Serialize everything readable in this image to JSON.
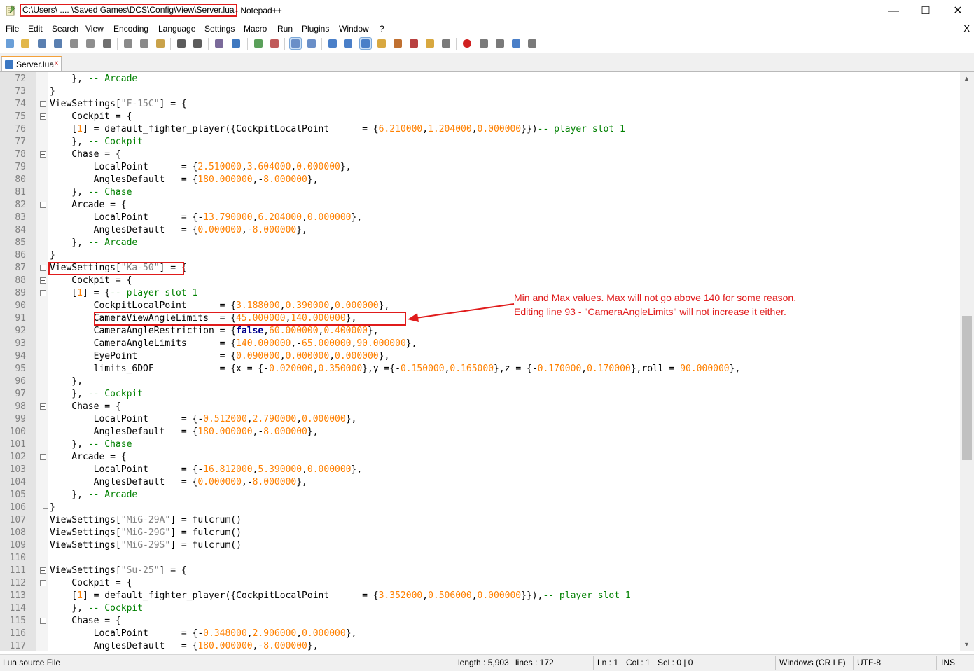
{
  "window": {
    "title_path": "C:\\Users\\ .... \\Saved Games\\DCS\\Config\\View\\Server.lua",
    "title_app": " - Notepad++",
    "minimize": "—",
    "maximize": "☐",
    "close": "✕"
  },
  "menu": {
    "items": [
      "File",
      "Edit",
      "Search",
      "View",
      "Encoding",
      "Language",
      "Settings",
      "Macro",
      "Run",
      "Plugins",
      "Window",
      "?"
    ],
    "close_doc": "X"
  },
  "toolbar": {
    "icons": [
      "new-file-icon",
      "open-file-icon",
      "save-icon",
      "save-all-icon",
      "close-icon",
      "close-all-icon",
      "print-icon",
      "cut-icon",
      "copy-icon",
      "paste-icon",
      "undo-icon",
      "redo-icon",
      "find-icon",
      "replace-icon",
      "zoom-in-icon",
      "zoom-out-icon",
      "sync-vertical-icon",
      "sync-horizontal-icon",
      "word-wrap-icon",
      "show-all-chars-icon",
      "indent-guide-icon",
      "udl-icon",
      "doc-map-icon",
      "function-list-icon",
      "folder-workspace-icon",
      "monitor-icon",
      "macro-record-icon",
      "macro-stop-icon",
      "macro-play-icon",
      "macro-run-multiple-icon",
      "macro-save-icon"
    ]
  },
  "tab": {
    "label": "Server.lua",
    "close": "x"
  },
  "editor": {
    "lines": [
      {
        "n": "72",
        "html": "    }, <span class=\"c\">-- Arcade</span>"
      },
      {
        "n": "73",
        "html": "}"
      },
      {
        "n": "74",
        "html": "ViewSettings[<span class=\"s\">\"F-15C\"</span>] = {"
      },
      {
        "n": "75",
        "html": "    Cockpit = {"
      },
      {
        "n": "76",
        "html": "    [<span class=\"n\">1</span>] = default_fighter_player({CockpitLocalPoint      = {<span class=\"n\">6.210000</span>,<span class=\"n\">1.204000</span>,<span class=\"n\">0.000000</span>}})<span class=\"c\">-- player slot 1</span>"
      },
      {
        "n": "77",
        "html": "    }, <span class=\"c\">-- Cockpit</span>"
      },
      {
        "n": "78",
        "html": "    Chase = {"
      },
      {
        "n": "79",
        "html": "        LocalPoint      = {<span class=\"n\">2.510000</span>,<span class=\"n\">3.604000</span>,<span class=\"n\">0.000000</span>},"
      },
      {
        "n": "80",
        "html": "        AnglesDefault   = {<span class=\"n\">180.000000</span>,-<span class=\"n\">8.000000</span>},"
      },
      {
        "n": "81",
        "html": "    }, <span class=\"c\">-- Chase</span>"
      },
      {
        "n": "82",
        "html": "    Arcade = {"
      },
      {
        "n": "83",
        "html": "        LocalPoint      = {-<span class=\"n\">13.790000</span>,<span class=\"n\">6.204000</span>,<span class=\"n\">0.000000</span>},"
      },
      {
        "n": "84",
        "html": "        AnglesDefault   = {<span class=\"n\">0.000000</span>,-<span class=\"n\">8.000000</span>},"
      },
      {
        "n": "85",
        "html": "    }, <span class=\"c\">-- Arcade</span>"
      },
      {
        "n": "86",
        "html": "}"
      },
      {
        "n": "87",
        "html": "ViewSettings[<span class=\"s\">\"Ka-50\"</span>] = {"
      },
      {
        "n": "88",
        "html": "    Cockpit = {"
      },
      {
        "n": "89",
        "html": "    [<span class=\"n\">1</span>] = {<span class=\"c\">-- player slot 1</span>"
      },
      {
        "n": "90",
        "html": "        CockpitLocalPoint      = {<span class=\"n\">3.188000</span>,<span class=\"n\">0.390000</span>,<span class=\"n\">0.000000</span>},"
      },
      {
        "n": "91",
        "html": "        CameraViewAngleLimits  = {<span class=\"n\">45.000000</span>,<span class=\"n\">140.000000</span>},"
      },
      {
        "n": "92",
        "html": "        CameraAngleRestriction = {<span class=\"k\">false</span>,<span class=\"n\">60.000000</span>,<span class=\"n\">0.400000</span>},"
      },
      {
        "n": "93",
        "html": "        CameraAngleLimits      = {<span class=\"n\">140.000000</span>,-<span class=\"n\">65.000000</span>,<span class=\"n\">90.000000</span>},"
      },
      {
        "n": "94",
        "html": "        EyePoint               = {<span class=\"n\">0.090000</span>,<span class=\"n\">0.000000</span>,<span class=\"n\">0.000000</span>},"
      },
      {
        "n": "95",
        "html": "        limits_6DOF            = {x = {-<span class=\"n\">0.020000</span>,<span class=\"n\">0.350000</span>},y ={-<span class=\"n\">0.150000</span>,<span class=\"n\">0.165000</span>},z = {-<span class=\"n\">0.170000</span>,<span class=\"n\">0.170000</span>},roll = <span class=\"n\">90.000000</span>},"
      },
      {
        "n": "96",
        "html": "    },"
      },
      {
        "n": "97",
        "html": "    }, <span class=\"c\">-- Cockpit</span>"
      },
      {
        "n": "98",
        "html": "    Chase = {"
      },
      {
        "n": "99",
        "html": "        LocalPoint      = {-<span class=\"n\">0.512000</span>,<span class=\"n\">2.790000</span>,<span class=\"n\">0.000000</span>},"
      },
      {
        "n": "100",
        "html": "        AnglesDefault   = {<span class=\"n\">180.000000</span>,-<span class=\"n\">8.000000</span>},"
      },
      {
        "n": "101",
        "html": "    }, <span class=\"c\">-- Chase</span>"
      },
      {
        "n": "102",
        "html": "    Arcade = {"
      },
      {
        "n": "103",
        "html": "        LocalPoint      = {-<span class=\"n\">16.812000</span>,<span class=\"n\">5.390000</span>,<span class=\"n\">0.000000</span>},"
      },
      {
        "n": "104",
        "html": "        AnglesDefault   = {<span class=\"n\">0.000000</span>,-<span class=\"n\">8.000000</span>},"
      },
      {
        "n": "105",
        "html": "    }, <span class=\"c\">-- Arcade</span>"
      },
      {
        "n": "106",
        "html": "}"
      },
      {
        "n": "107",
        "html": "ViewSettings[<span class=\"s\">\"MiG-29A\"</span>] = fulcrum()"
      },
      {
        "n": "108",
        "html": "ViewSettings[<span class=\"s\">\"MiG-29G\"</span>] = fulcrum()"
      },
      {
        "n": "109",
        "html": "ViewSettings[<span class=\"s\">\"MiG-29S\"</span>] = fulcrum()"
      },
      {
        "n": "110",
        "html": ""
      },
      {
        "n": "111",
        "html": "ViewSettings[<span class=\"s\">\"Su-25\"</span>] = {"
      },
      {
        "n": "112",
        "html": "    Cockpit = {"
      },
      {
        "n": "113",
        "html": "    [<span class=\"n\">1</span>] = default_fighter_player({CockpitLocalPoint      = {<span class=\"n\">3.352000</span>,<span class=\"n\">0.506000</span>,<span class=\"n\">0.000000</span>}}),<span class=\"c\">-- player slot 1</span>"
      },
      {
        "n": "114",
        "html": "    }, <span class=\"c\">-- Cockpit</span>"
      },
      {
        "n": "115",
        "html": "    Chase = {"
      },
      {
        "n": "116",
        "html": "        LocalPoint      = {-<span class=\"n\">0.348000</span>,<span class=\"n\">2.906000</span>,<span class=\"n\">0.000000</span>},"
      },
      {
        "n": "117",
        "html": "        AnglesDefault   = {<span class=\"n\">180.000000</span>,-<span class=\"n\">8.000000</span>},"
      }
    ]
  },
  "annotation": {
    "line1": "Min and Max values. Max will not go above 140 for some reason.",
    "line2": "Editing line 93 - \"CameraAngleLimits\" will not increase it either.",
    "color": "#e01b1b"
  },
  "status": {
    "file_type": "Lua source File",
    "length": "length : 5,903",
    "lines": "lines : 172",
    "ln": "Ln : 1",
    "col": "Col : 1",
    "sel": "Sel : 0 | 0",
    "eol": "Windows (CR LF)",
    "encoding": "UTF-8",
    "mode": "INS"
  }
}
